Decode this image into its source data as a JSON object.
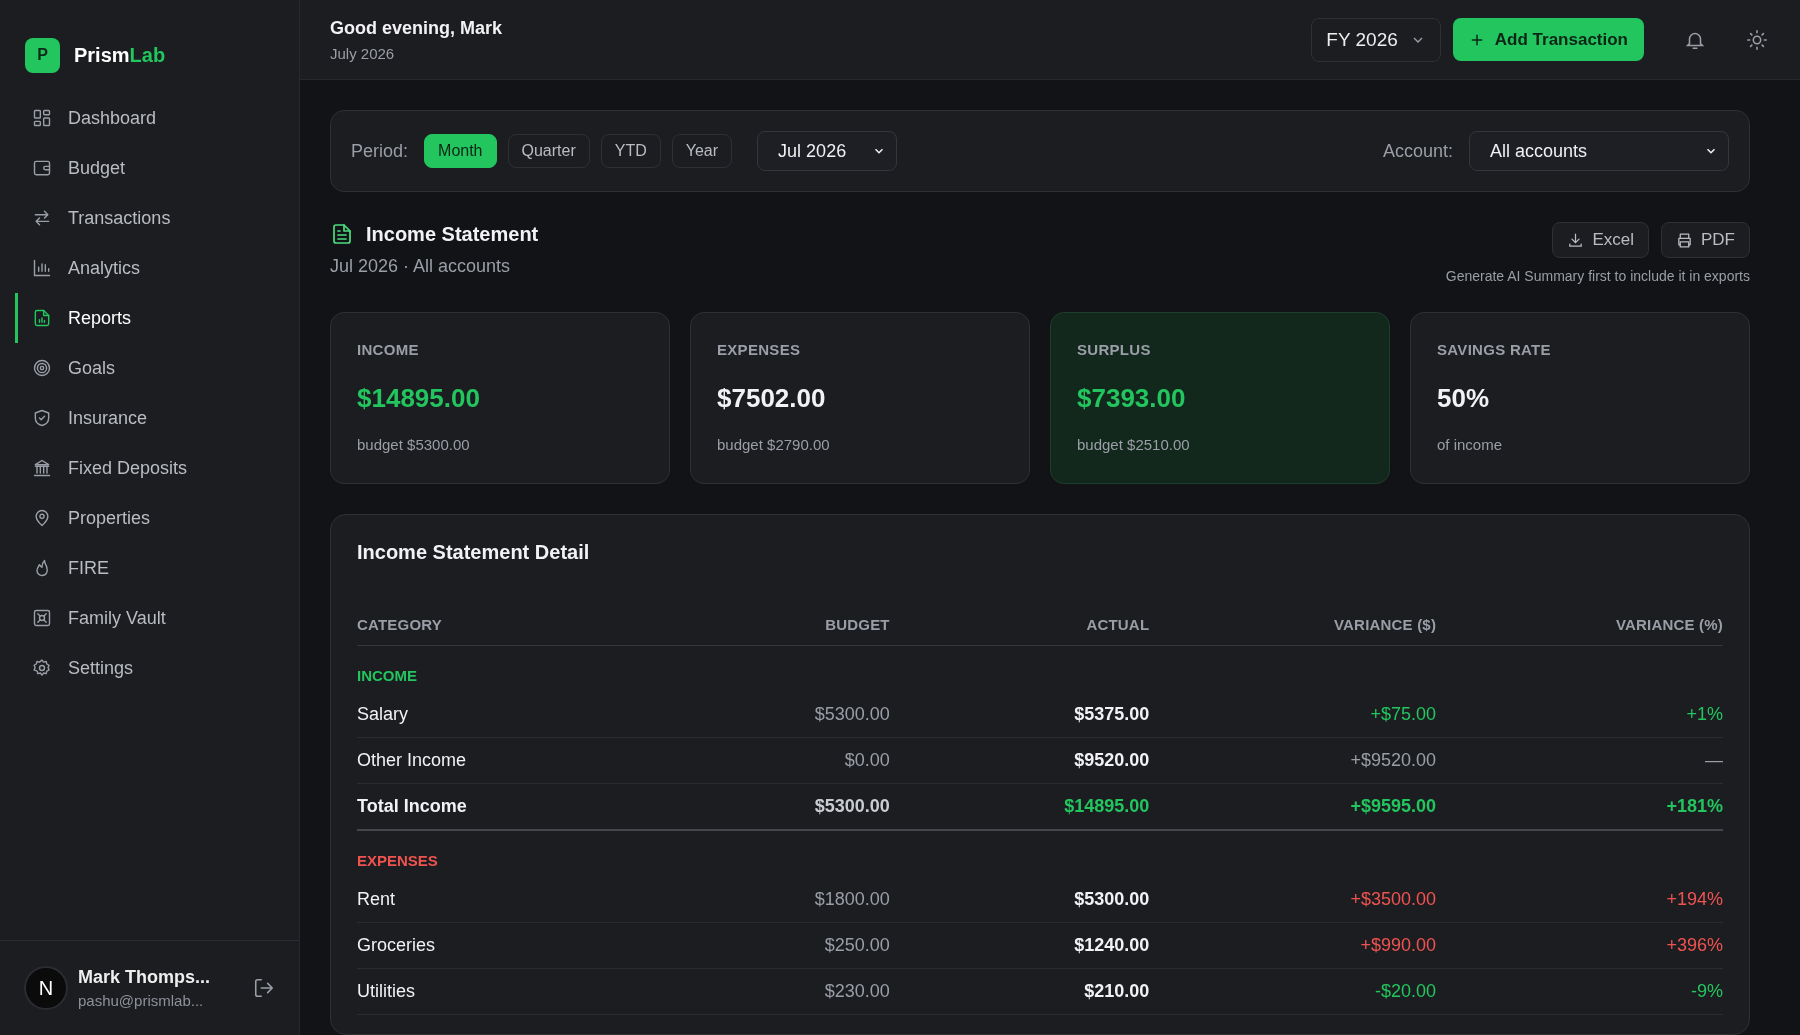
{
  "brand": {
    "mark": "P",
    "name_a": "Prism",
    "name_b": "Lab"
  },
  "sidebar": {
    "items": [
      {
        "label": "Dashboard",
        "selected": false
      },
      {
        "label": "Budget",
        "selected": false
      },
      {
        "label": "Transactions",
        "selected": false
      },
      {
        "label": "Analytics",
        "selected": false
      },
      {
        "label": "Reports",
        "selected": true
      },
      {
        "label": "Goals",
        "selected": false
      },
      {
        "label": "Insurance",
        "selected": false
      },
      {
        "label": "Fixed Deposits",
        "selected": false
      },
      {
        "label": "Properties",
        "selected": false
      },
      {
        "label": "FIRE",
        "selected": false
      },
      {
        "label": "Family Vault",
        "selected": false
      },
      {
        "label": "Settings",
        "selected": false
      }
    ]
  },
  "user": {
    "initial": "N",
    "name": "Mark Thomps...",
    "email": "pashu@prismlab..."
  },
  "header": {
    "greeting": "Good evening, Mark",
    "date": "July 2026",
    "fiscal_year": "FY 2026",
    "add_button": "Add Transaction"
  },
  "filters": {
    "period_label": "Period:",
    "periods": [
      {
        "label": "Month",
        "selected": true
      },
      {
        "label": "Quarter",
        "selected": false
      },
      {
        "label": "YTD",
        "selected": false
      },
      {
        "label": "Year",
        "selected": false
      }
    ],
    "month": "Jul 2026",
    "account_label": "Account:",
    "account": "All accounts"
  },
  "report": {
    "title": "Income Statement",
    "subtitle": "Jul 2026 · All accounts",
    "exports": [
      "Excel",
      "PDF"
    ],
    "export_note": "Generate AI Summary first to include it in exports"
  },
  "cards": [
    {
      "label": "INCOME",
      "value": "$14895.00",
      "note": "budget $5300.00",
      "color": "#22c55e",
      "highlighted": false
    },
    {
      "label": "EXPENSES",
      "value": "$7502.00",
      "note": "budget $2790.00",
      "color": "#f2f2f4",
      "highlighted": false
    },
    {
      "label": "SURPLUS",
      "value": "$7393.00",
      "note": "budget $2510.00",
      "color": "#22c55e",
      "highlighted": true
    },
    {
      "label": "SAVINGS RATE",
      "value": "50%",
      "note": "of income",
      "color": "#f2f2f4",
      "highlighted": false
    }
  ],
  "table": {
    "title": "Income Statement Detail",
    "columns": [
      "CATEGORY",
      "BUDGET",
      "ACTUAL",
      "VARIANCE ($)",
      "VARIANCE (%)"
    ],
    "rows": [
      {
        "kind": "section",
        "category": "INCOME",
        "color": "#22c55e"
      },
      {
        "kind": "item",
        "category": "Salary",
        "budget": "$5300.00",
        "actual": "$5375.00",
        "variance": "+$75.00",
        "variance_pct": "+1%",
        "color": "#22c55e"
      },
      {
        "kind": "item",
        "category": "Other Income",
        "budget": "$0.00",
        "actual": "$9520.00",
        "variance": "+$9520.00",
        "variance_pct": "—",
        "color": "#9a9ea6"
      },
      {
        "kind": "total",
        "category": "Total Income",
        "budget": "$5300.00",
        "actual": "$14895.00",
        "variance": "+$9595.00",
        "variance_pct": "+181%",
        "color": "#22c55e"
      },
      {
        "kind": "section",
        "category": "EXPENSES",
        "color": "#ef5350"
      },
      {
        "kind": "item",
        "category": "Rent",
        "budget": "$1800.00",
        "actual": "$5300.00",
        "variance": "+$3500.00",
        "variance_pct": "+194%",
        "color": "#ef5350"
      },
      {
        "kind": "item",
        "category": "Groceries",
        "budget": "$250.00",
        "actual": "$1240.00",
        "variance": "+$990.00",
        "variance_pct": "+396%",
        "color": "#ef5350"
      },
      {
        "kind": "item",
        "category": "Utilities",
        "budget": "$230.00",
        "actual": "$210.00",
        "variance": "-$20.00",
        "variance_pct": "-9%",
        "color": "#22c55e"
      }
    ]
  }
}
